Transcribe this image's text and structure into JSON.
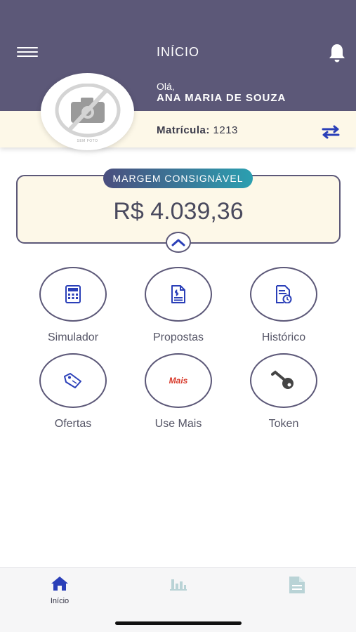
{
  "header": {
    "title": "INÍCIO",
    "greeting": "Olá,",
    "user_name": "ANA MARIA DE SOUZA"
  },
  "profile": {
    "photo_caption": "SEM FOTO",
    "matricula_label": "Matrícula:",
    "matricula_value": "1213"
  },
  "margin": {
    "label": "MARGEM CONSIGNÁVEL",
    "value": "R$ 4.039,36"
  },
  "actions": [
    {
      "label": "Simulador",
      "icon": "calculator-icon"
    },
    {
      "label": "Propostas",
      "icon": "dollar-document-icon"
    },
    {
      "label": "Histórico",
      "icon": "history-document-icon"
    },
    {
      "label": "Ofertas",
      "icon": "tag-icon"
    },
    {
      "label": "Use Mais",
      "icon": "use-mais-logo",
      "logo_text": "Mais"
    },
    {
      "label": "Token",
      "icon": "key-icon"
    }
  ],
  "bottom_nav": [
    {
      "label": "Início",
      "icon": "home-icon",
      "active": true
    },
    {
      "label": "",
      "icon": "bar-chart-icon",
      "active": false
    },
    {
      "label": "",
      "icon": "document-icon",
      "active": false
    }
  ],
  "colors": {
    "header_bg": "#5c5878",
    "card_bg": "#fdf8e8",
    "accent_blue": "#2a3fb8",
    "gradient_start": "#4a4e7e",
    "gradient_end": "#2b9fb0",
    "inactive_icon": "#b9d3d6"
  }
}
